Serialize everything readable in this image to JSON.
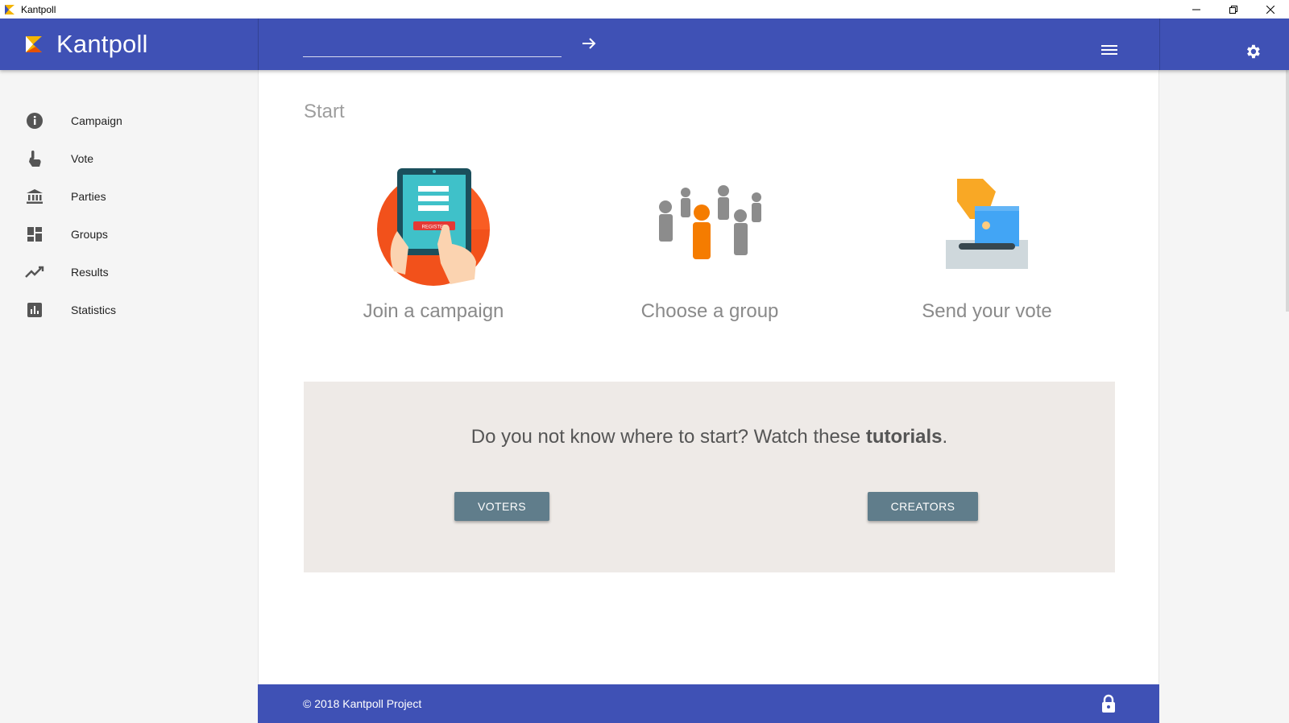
{
  "window": {
    "title": "Kantpoll"
  },
  "header": {
    "app_name": "Kantpoll",
    "search_value": "",
    "icons": [
      "arrow-forward-icon",
      "menu-icon",
      "gear-icon"
    ]
  },
  "sidebar": {
    "items": [
      {
        "label": "Campaign",
        "icon": "info-icon"
      },
      {
        "label": "Vote",
        "icon": "touch-icon"
      },
      {
        "label": "Parties",
        "icon": "bank-icon"
      },
      {
        "label": "Groups",
        "icon": "dashboard-icon"
      },
      {
        "label": "Results",
        "icon": "trending-icon"
      },
      {
        "label": "Statistics",
        "icon": "bar-chart-icon"
      }
    ]
  },
  "main": {
    "page_title": "Start",
    "steps": [
      {
        "caption": "Join a campaign",
        "badge": "REGISTER"
      },
      {
        "caption": "Choose a group"
      },
      {
        "caption": "Send your vote"
      }
    ],
    "tutorial": {
      "text_before": "Do you not know where to start? Watch these ",
      "text_bold": "tutorials",
      "text_after": ".",
      "voters_label": "VOTERS",
      "creators_label": "CREATORS"
    }
  },
  "footer": {
    "copyright": "© 2018 Kantpoll Project"
  },
  "colors": {
    "primary": "#3f51b5",
    "button": "#607d8b",
    "tutorial_bg": "#eeeae7",
    "accent_orange": "#f57c00"
  }
}
